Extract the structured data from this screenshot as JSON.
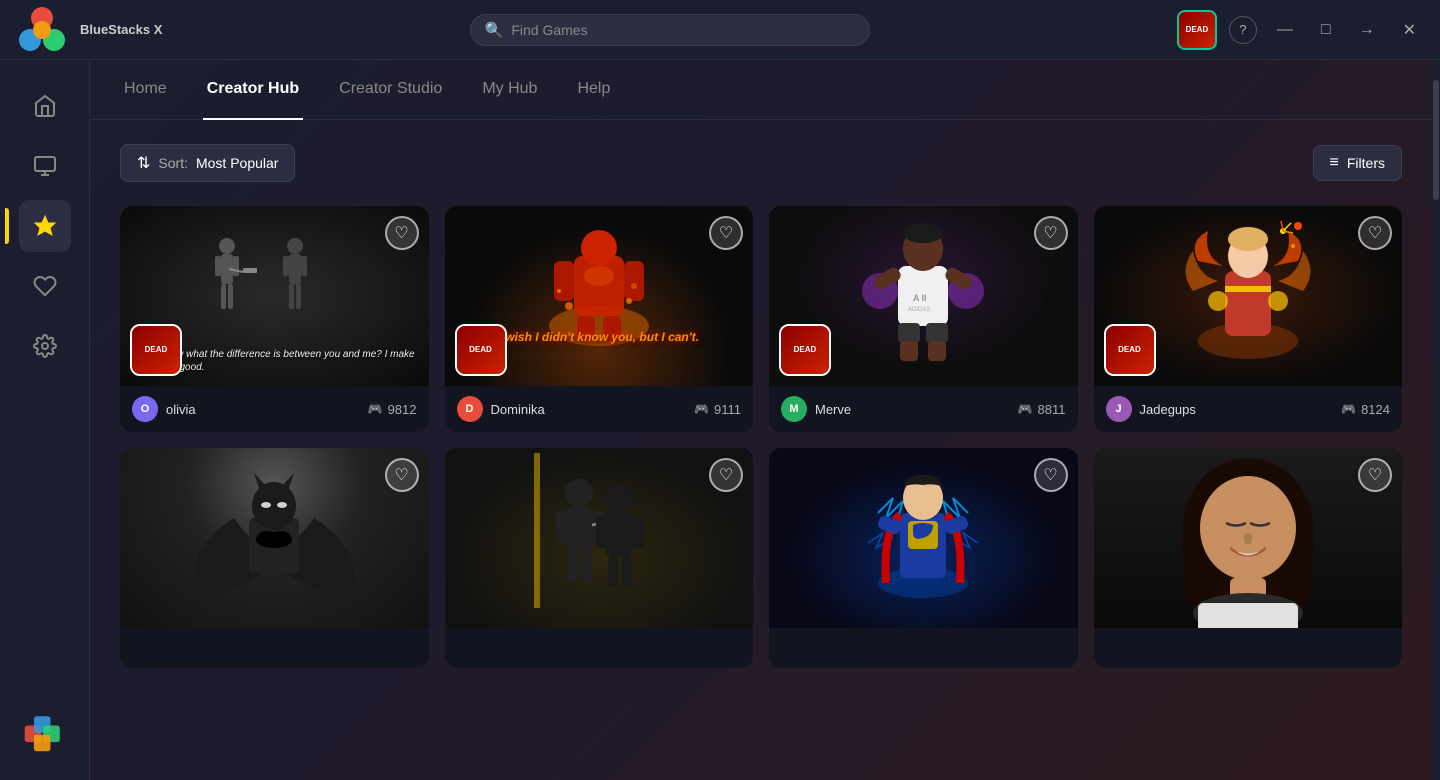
{
  "app": {
    "title": "BlueStacks X",
    "logo_text": "BlueStacks X"
  },
  "titlebar": {
    "search_placeholder": "Find Games",
    "help_icon": "?",
    "minimize_icon": "—",
    "maximize_icon": "□",
    "forward_icon": "→",
    "close_icon": "✕"
  },
  "sidebar": {
    "items": [
      {
        "id": "home",
        "icon": "⌂",
        "label": "Home",
        "active": false
      },
      {
        "id": "store",
        "icon": "🛍",
        "label": "Store",
        "active": false
      },
      {
        "id": "creator",
        "icon": "★",
        "label": "Creator",
        "active": true
      },
      {
        "id": "favorites",
        "icon": "♡",
        "label": "Favorites",
        "active": false
      },
      {
        "id": "settings",
        "icon": "⚙",
        "label": "Settings",
        "active": false
      }
    ]
  },
  "nav": {
    "tabs": [
      {
        "id": "home",
        "label": "Home",
        "active": false
      },
      {
        "id": "creator-hub",
        "label": "Creator Hub",
        "active": true
      },
      {
        "id": "creator-studio",
        "label": "Creator Studio",
        "active": false
      },
      {
        "id": "my-hub",
        "label": "My Hub",
        "active": false
      },
      {
        "id": "help",
        "label": "Help",
        "active": false
      }
    ]
  },
  "toolbar": {
    "sort_label": "Sort:",
    "sort_value": "Most Popular",
    "filter_label": "Filters"
  },
  "cards": [
    {
      "id": "card1",
      "author": "olivia",
      "plays": "9812",
      "liked": false,
      "bg_type": "men_in_black",
      "text_overlay": "You know what the difference is between you and me? I make this look good."
    },
    {
      "id": "card2",
      "author": "Dominika",
      "plays": "9111",
      "liked": false,
      "bg_type": "soldier_fire",
      "text_overlay": "I wish I didn't know you, but I can't."
    },
    {
      "id": "card3",
      "author": "Merve",
      "plays": "8811",
      "liked": false,
      "bg_type": "soccer_player",
      "text_overlay": ""
    },
    {
      "id": "card4",
      "author": "Jadegups",
      "plays": "8124",
      "liked": false,
      "bg_type": "captain_marvel",
      "text_overlay": ""
    },
    {
      "id": "card5",
      "author": "",
      "plays": "",
      "liked": false,
      "bg_type": "batman",
      "text_overlay": ""
    },
    {
      "id": "card6",
      "author": "",
      "plays": "",
      "liked": false,
      "bg_type": "soldiers_gold",
      "text_overlay": ""
    },
    {
      "id": "card7",
      "author": "",
      "plays": "",
      "liked": false,
      "bg_type": "superman_blue",
      "text_overlay": ""
    },
    {
      "id": "card8",
      "author": "",
      "plays": "",
      "liked": false,
      "bg_type": "woman_portrait",
      "text_overlay": ""
    }
  ],
  "icons": {
    "heart": "♥",
    "gamepad": "🎮",
    "sort": "⇅",
    "filter": "≡",
    "search": "🔍"
  }
}
